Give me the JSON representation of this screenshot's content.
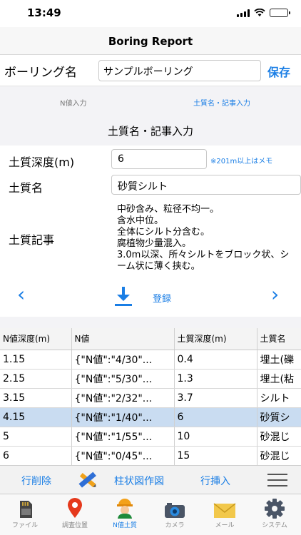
{
  "status_bar": {
    "time": "13:49"
  },
  "nav": {
    "title": "Boring Report"
  },
  "boring": {
    "label": "ボーリング名",
    "value": "サンプルボーリング",
    "save_label": "保存"
  },
  "tabs": {
    "n_value": "N値入力",
    "soil": "土質名・記事入力"
  },
  "section": {
    "title": "土質名・記事入力"
  },
  "form": {
    "depth_label": "土質深度(m)",
    "depth_value": "6",
    "depth_hint": "※201m以上はメモ",
    "soil_label": "土質名",
    "soil_value": "砂質シルト",
    "remarks_label": "土質記事",
    "remarks_value": "中砂含み、粒径不均一。\n含水中位。\n全体にシルト分含む。\n腐植物少量混入。\n3.0m以深、所々シルトをブロック状、シーム状に薄く挟む。"
  },
  "controls": {
    "prev": "‹",
    "next": "›",
    "register_label": "登録"
  },
  "table": {
    "headers": [
      "N値深度(m)",
      "N値",
      "土質深度(m)",
      "土質名"
    ],
    "rows": [
      [
        "1.15",
        "{\"N値\":\"4/30\"...",
        "0.4",
        "埋土(礫"
      ],
      [
        "2.15",
        "{\"N値\":\"5/30\"...",
        "1.3",
        "埋土(粘"
      ],
      [
        "3.15",
        "{\"N値\":\"2/32\"...",
        "3.7",
        "シルト"
      ],
      [
        "4.15",
        "{\"N値\":\"1/40\"...",
        "6",
        "砂質シ"
      ],
      [
        "5",
        "{\"N値\":\"1/55\"...",
        "10",
        "砂混じ"
      ],
      [
        "6",
        "{\"N値\":\"0/45\"...",
        "15",
        "砂混じ"
      ]
    ],
    "selected_row": 3
  },
  "actions": {
    "delete_row": "行削除",
    "column_chart": "柱状図作図",
    "insert_row": "行挿入"
  },
  "tabbar": {
    "items": [
      {
        "label": "ファイル",
        "icon": "sd-card-icon"
      },
      {
        "label": "調査位置",
        "icon": "map-pin-icon"
      },
      {
        "label": "N値土質",
        "icon": "worker-icon"
      },
      {
        "label": "カメラ",
        "icon": "camera-icon"
      },
      {
        "label": "メール",
        "icon": "mail-icon"
      },
      {
        "label": "システム",
        "icon": "gear-icon"
      }
    ],
    "active": 2
  },
  "colors": {
    "accent": "#1a7ee5",
    "selected_row": "#c9dcf1",
    "battery": "#35c759"
  }
}
